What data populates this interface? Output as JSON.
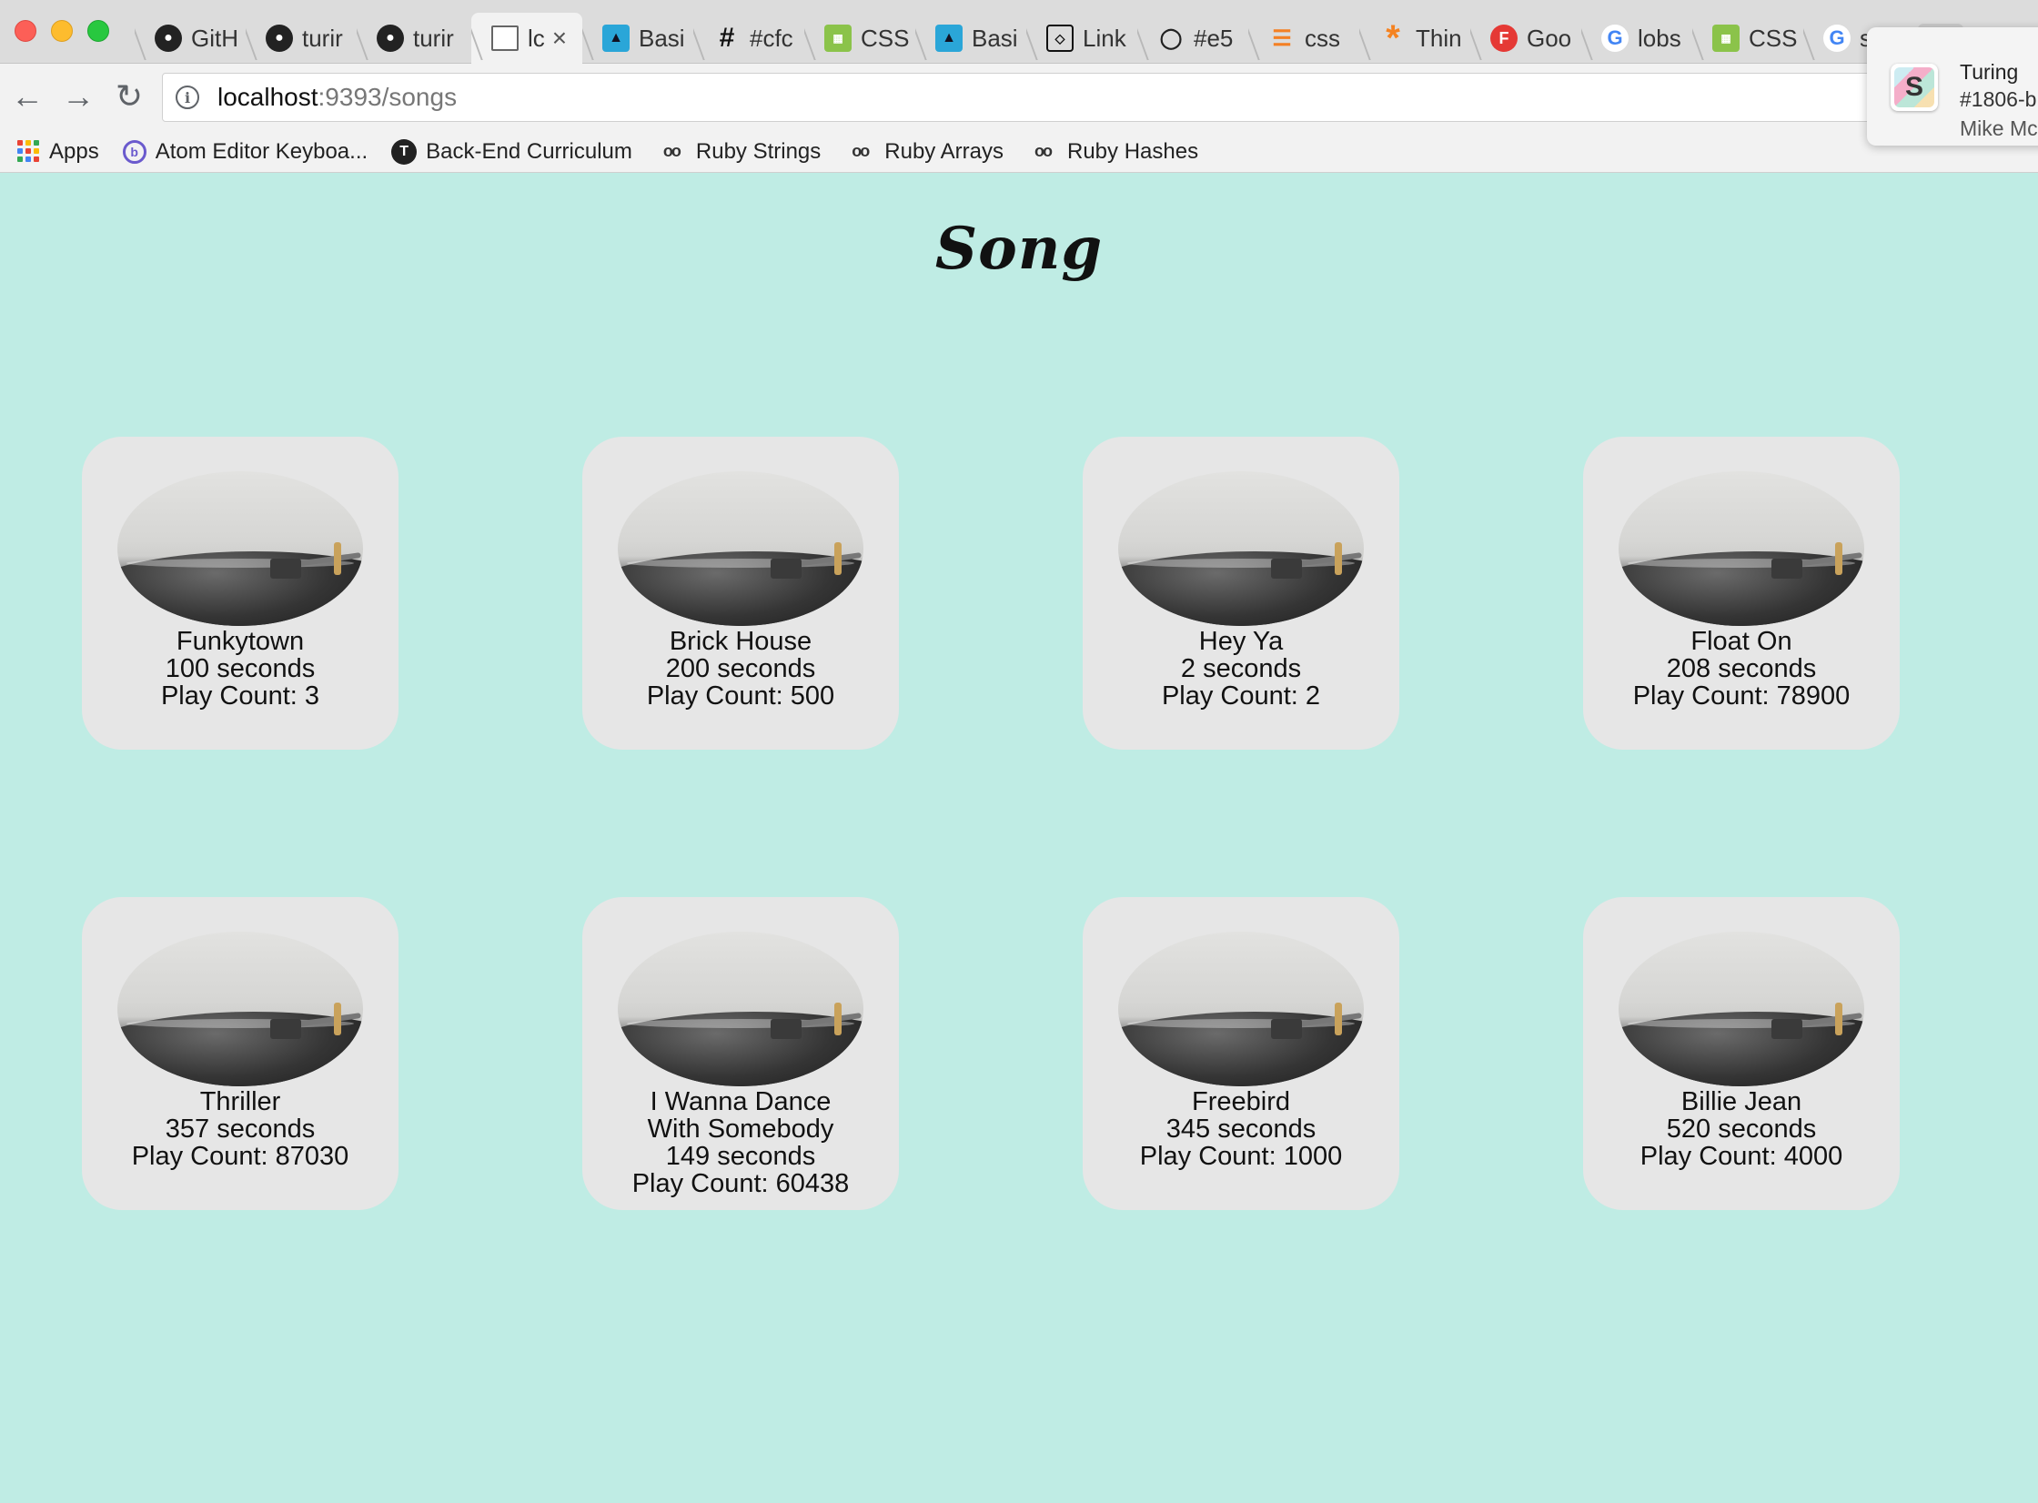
{
  "browser": {
    "tabs": [
      {
        "title": "GitH",
        "icon": "github-icon"
      },
      {
        "title": "turir",
        "icon": "github-icon"
      },
      {
        "title": "turir",
        "icon": "github-icon"
      },
      {
        "title": "lc",
        "icon": "page-icon",
        "active": true
      },
      {
        "title": "Basi",
        "icon": "panther-icon"
      },
      {
        "title": "#cfc",
        "icon": "hash-icon"
      },
      {
        "title": "CSS",
        "icon": "css-icon"
      },
      {
        "title": "Basi",
        "icon": "panther-icon"
      },
      {
        "title": "Link",
        "icon": "codepen-icon"
      },
      {
        "title": "#e5",
        "icon": "pin-icon"
      },
      {
        "title": "css",
        "icon": "stack-icon"
      },
      {
        "title": "Thin",
        "icon": "asterisk-icon"
      },
      {
        "title": "Goo",
        "icon": "f-icon"
      },
      {
        "title": "lobs",
        "icon": "google-icon"
      },
      {
        "title": "CSS",
        "icon": "css-icon"
      },
      {
        "title": "s",
        "icon": "google-icon"
      }
    ],
    "address": {
      "host": "localhost",
      "rest": ":9393/songs"
    },
    "bookmarks": [
      {
        "label": "Apps",
        "icon": "apps-icon"
      },
      {
        "label": "Atom Editor Keyboa...",
        "icon": "atom-icon"
      },
      {
        "label": "Back-End Curriculum",
        "icon": "turing-icon"
      },
      {
        "label": "Ruby Strings",
        "icon": "glasses-icon"
      },
      {
        "label": "Ruby Arrays",
        "icon": "glasses-icon"
      },
      {
        "label": "Ruby Hashes",
        "icon": "glasses-icon"
      }
    ]
  },
  "notification": {
    "title": "Turing",
    "channel": "#1806-b",
    "sender": "Mike Mc"
  },
  "page": {
    "heading": "Song",
    "songs": [
      {
        "name": "Funkytown",
        "duration": "100 seconds",
        "play_count": "Play Count: 3"
      },
      {
        "name": "Brick House",
        "duration": "200 seconds",
        "play_count": "Play Count: 500"
      },
      {
        "name": "Hey Ya",
        "duration": "2 seconds",
        "play_count": "Play Count: 2"
      },
      {
        "name": "Float On",
        "duration": "208 seconds",
        "play_count": "Play Count: 78900"
      },
      {
        "name": "Thriller",
        "duration": "357 seconds",
        "play_count": "Play Count: 87030"
      },
      {
        "name": "I Wanna Dance With Somebody",
        "duration": "149 seconds",
        "play_count": "Play Count: 60438"
      },
      {
        "name": "Freebird",
        "duration": "345 seconds",
        "play_count": "Play Count: 1000"
      },
      {
        "name": "Billie Jean",
        "duration": "520 seconds",
        "play_count": "Play Count: 4000"
      }
    ]
  },
  "colors": {
    "page_background": "#bfece4",
    "card_background": "#e6e6e6"
  }
}
